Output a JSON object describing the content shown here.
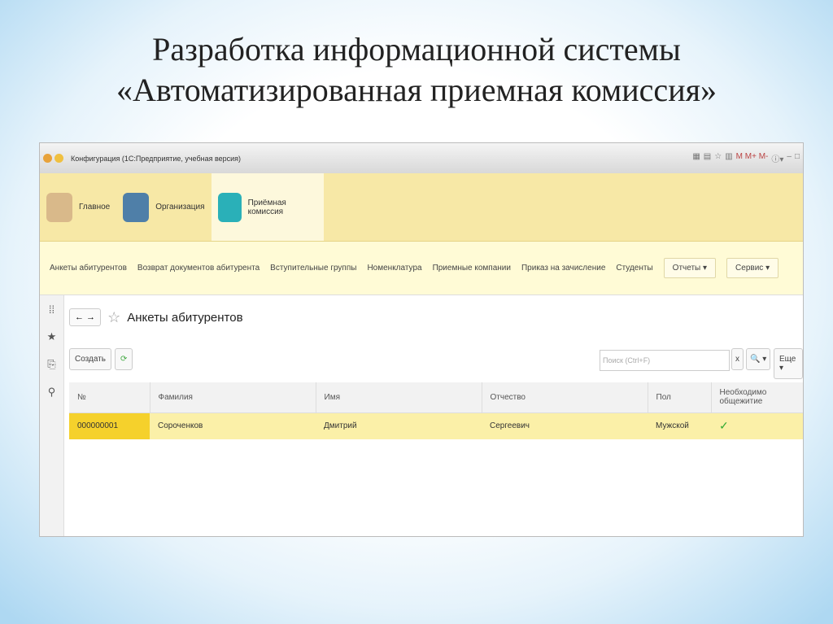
{
  "slide_title_line1": "Разработка информационной системы",
  "slide_title_line2": "«Автоматизированная приемная комиссия»",
  "window": {
    "title": "Конфигурация (1С:Предприятие, учебная версия)",
    "toolbar_text": "M M+ M-"
  },
  "sections": [
    {
      "label": "Главное"
    },
    {
      "label": "Организация"
    },
    {
      "label": "Приёмная комиссия"
    }
  ],
  "nav": [
    "Анкеты абитурентов",
    "Возврат документов абитурента",
    "Вступительные группы",
    "Номенклатура",
    "Приемные компании",
    "Приказ на зачисление",
    "Студенты"
  ],
  "nav_dropdowns": [
    "Отчеты ▾",
    "Сервис ▾"
  ],
  "page": {
    "title": "Анкеты абитурентов",
    "create": "Создать",
    "search_placeholder": "Поиск (Ctrl+F)",
    "clear": "x",
    "search_btn": "🔍 ▾",
    "more": "Еще ▾"
  },
  "table": {
    "headers": [
      "№",
      "Фамилия",
      "Имя",
      "Отчество",
      "Пол",
      "Необходимо общежитие"
    ],
    "rows": [
      {
        "num": "000000001",
        "surname": "Сороченков",
        "name": "Дмитрий",
        "patronymic": "Сергеевич",
        "gender": "Мужской",
        "dorm": "✓"
      }
    ]
  }
}
